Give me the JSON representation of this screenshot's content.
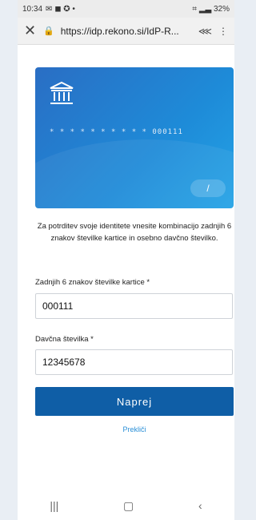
{
  "status": {
    "time": "10:34",
    "icons": "✉ ◼ ✪ •",
    "right": "⌗ ▂▃ 32%"
  },
  "browser": {
    "url": "https://idp.rekono.si/IdP-R..."
  },
  "card": {
    "masked_number": "* * * *   * * * *   * *  000111",
    "pill_text": "/"
  },
  "intro_text": "Za potrditev svoje identitete vnesite kombinacijo zadnjih 6 znakov številke kartice in osebno davčno številko.",
  "form": {
    "card_label": "Zadnjih 6 znakov številke kartice *",
    "card_value": "000111",
    "tax_label": "Davčna številka *",
    "tax_value": "12345678",
    "submit_label": "Naprej",
    "cancel_label": "Prekliči"
  },
  "nav": {
    "recent": "|||",
    "home": "▢",
    "back": "‹"
  },
  "colors": {
    "primary": "#0f5ea6",
    "link": "#2a8fd7"
  }
}
